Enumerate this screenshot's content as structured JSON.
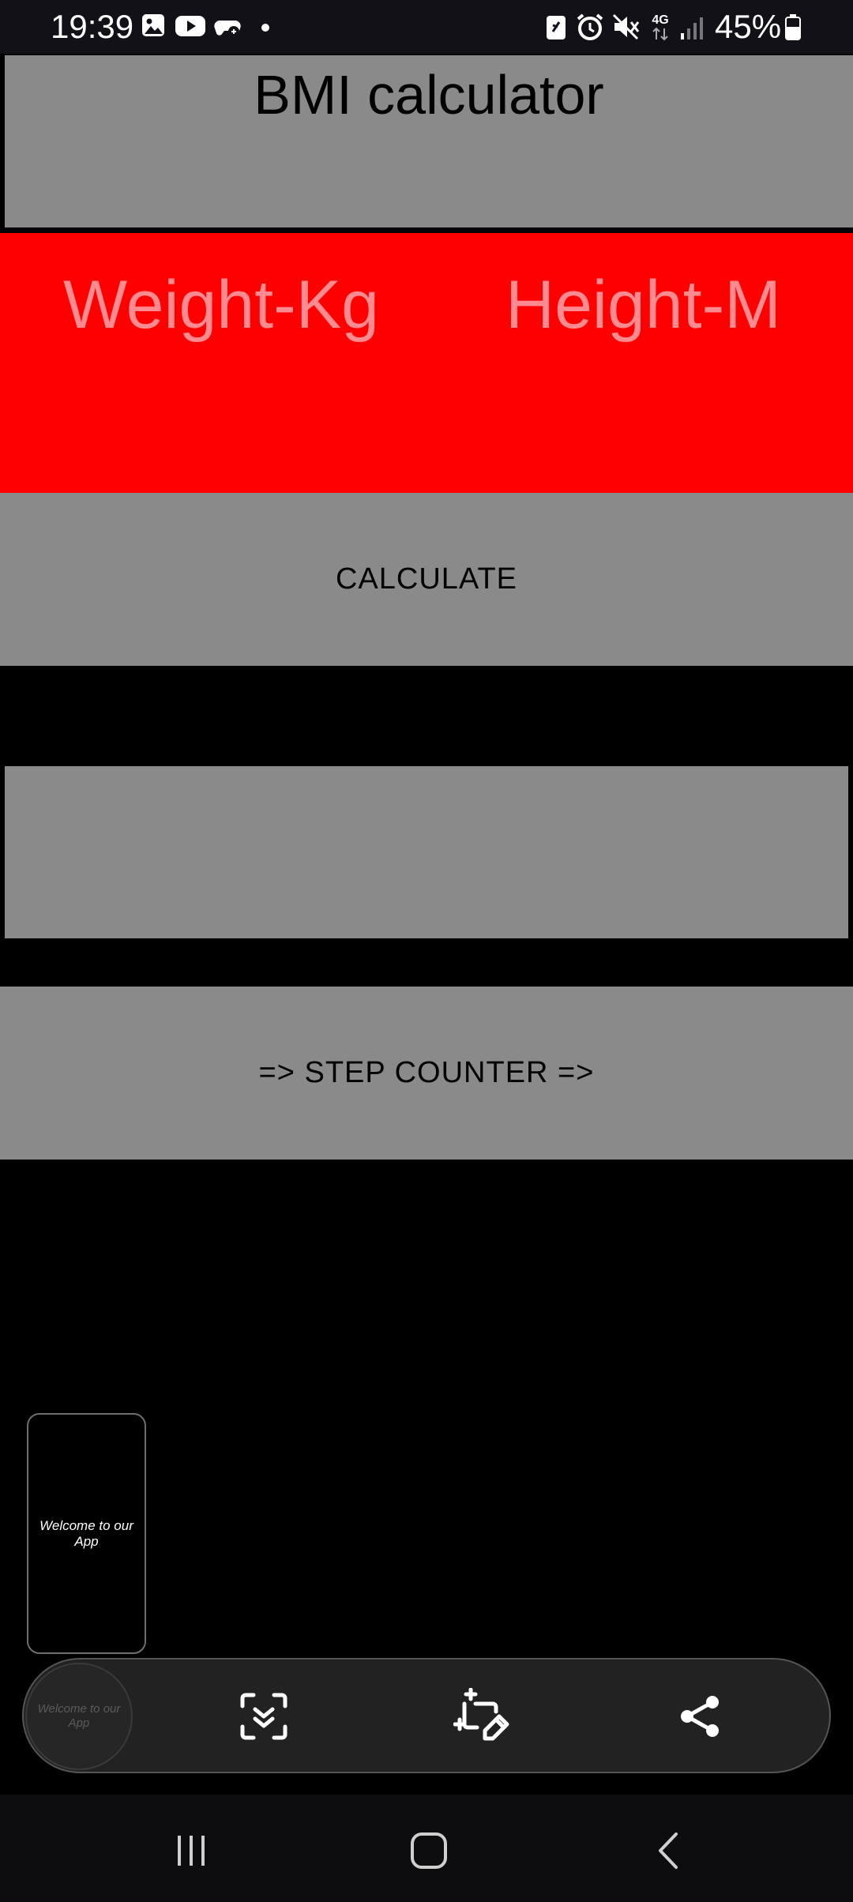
{
  "status_bar": {
    "time": "19:39",
    "battery_percent": "45%",
    "network": "4G",
    "left_icons": [
      "gallery-icon",
      "youtube-icon",
      "game-icon",
      "dot-icon"
    ],
    "right_icons": [
      "nfc-icon",
      "alarm-icon",
      "mute-icon",
      "network-4g-icon",
      "signal-icon",
      "battery-icon"
    ]
  },
  "app": {
    "title": "BMI calculator",
    "weight_placeholder": "Weight-Kg",
    "height_placeholder": "Height-M",
    "calculate_label": "CALCULATE",
    "result_text": "",
    "step_counter_label": "=> STEP COUNTER =>",
    "colors": {
      "panel": "#8a8a8a",
      "input_bg": "#ff0000",
      "hint": "#ff8a90",
      "background": "#000000"
    }
  },
  "screenshot_overlay": {
    "thumbnail_text": "Welcome to our App",
    "preview_text": "Welcome to our App",
    "actions": [
      "scroll-capture-icon",
      "edit-crop-icon",
      "share-icon"
    ]
  },
  "nav_bar": {
    "buttons": [
      "recents-icon",
      "home-icon",
      "back-icon"
    ]
  }
}
